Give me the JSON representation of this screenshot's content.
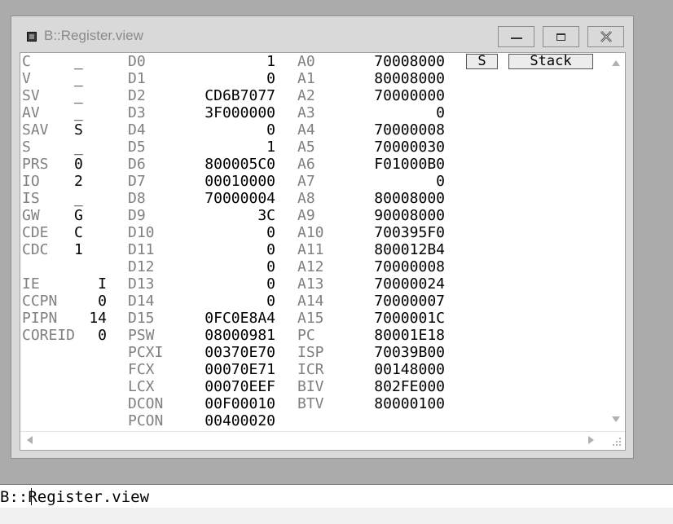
{
  "window": {
    "title": "B::Register.view"
  },
  "flags": [
    {
      "name": "C",
      "value": "_"
    },
    {
      "name": "V",
      "value": "_"
    },
    {
      "name": "SV",
      "value": "_"
    },
    {
      "name": "AV",
      "value": "_"
    },
    {
      "name": "SAV",
      "value": "S"
    },
    {
      "name": "S",
      "value": "_"
    },
    {
      "name": "PRS",
      "value": "0"
    },
    {
      "name": "IO",
      "value": "2"
    },
    {
      "name": "IS",
      "value": "_"
    },
    {
      "name": "GW",
      "value": "G"
    },
    {
      "name": "CDE",
      "value": "C"
    },
    {
      "name": "CDC",
      "value": "1"
    }
  ],
  "int_flags": [
    {
      "name": "IE",
      "value": "I"
    },
    {
      "name": "CCPN",
      "value": "0"
    },
    {
      "name": "PIPN",
      "value": "14"
    },
    {
      "name": "COREID",
      "value": "0"
    }
  ],
  "dregs": [
    {
      "name": "D0",
      "value": "1"
    },
    {
      "name": "D1",
      "value": "0"
    },
    {
      "name": "D2",
      "value": "CD6B7077"
    },
    {
      "name": "D3",
      "value": "3F000000"
    },
    {
      "name": "D4",
      "value": "0"
    },
    {
      "name": "D5",
      "value": "1"
    },
    {
      "name": "D6",
      "value": "800005C0"
    },
    {
      "name": "D7",
      "value": "00010000"
    },
    {
      "name": "D8",
      "value": "70000004"
    },
    {
      "name": "D9",
      "value": "3C"
    },
    {
      "name": "D10",
      "value": "0"
    },
    {
      "name": "D11",
      "value": "0"
    },
    {
      "name": "D12",
      "value": "0"
    },
    {
      "name": "D13",
      "value": "0"
    },
    {
      "name": "D14",
      "value": "0"
    },
    {
      "name": "D15",
      "value": "0FC0E8A4"
    },
    {
      "name": "PSW",
      "value": "08000981"
    },
    {
      "name": "PCXI",
      "value": "00370E70"
    },
    {
      "name": "FCX",
      "value": "00070E71"
    },
    {
      "name": "LCX",
      "value": "00070EEF"
    },
    {
      "name": "DCON",
      "value": "00F00010"
    },
    {
      "name": "PCON",
      "value": "00400020"
    }
  ],
  "aregs": [
    {
      "name": "A0",
      "value": "70008000"
    },
    {
      "name": "A1",
      "value": "80008000"
    },
    {
      "name": "A2",
      "value": "70000000"
    },
    {
      "name": "A3",
      "value": "0"
    },
    {
      "name": "A4",
      "value": "70000008"
    },
    {
      "name": "A5",
      "value": "70000030"
    },
    {
      "name": "A6",
      "value": "F01000B0"
    },
    {
      "name": "A7",
      "value": "0"
    },
    {
      "name": "A8",
      "value": "80008000"
    },
    {
      "name": "A9",
      "value": "90008000"
    },
    {
      "name": "A10",
      "value": "700395F0"
    },
    {
      "name": "A11",
      "value": "800012B4"
    },
    {
      "name": "A12",
      "value": "70000008"
    },
    {
      "name": "A13",
      "value": "70000024"
    },
    {
      "name": "A14",
      "value": "70000007"
    },
    {
      "name": "A15",
      "value": "7000001C"
    },
    {
      "name": "PC",
      "value": "80001E18"
    },
    {
      "name": "ISP",
      "value": "70039B00"
    },
    {
      "name": "ICR",
      "value": "00148000"
    },
    {
      "name": "BIV",
      "value": "802FE000"
    },
    {
      "name": "BTV",
      "value": "80000100"
    }
  ],
  "buttons": {
    "s_label": "S",
    "stack_label": "Stack"
  },
  "command_line": {
    "text": "B::Register.view"
  },
  "icons": {
    "minimize": "minimize-icon",
    "maximize": "maximize-icon",
    "close": "close-icon"
  }
}
